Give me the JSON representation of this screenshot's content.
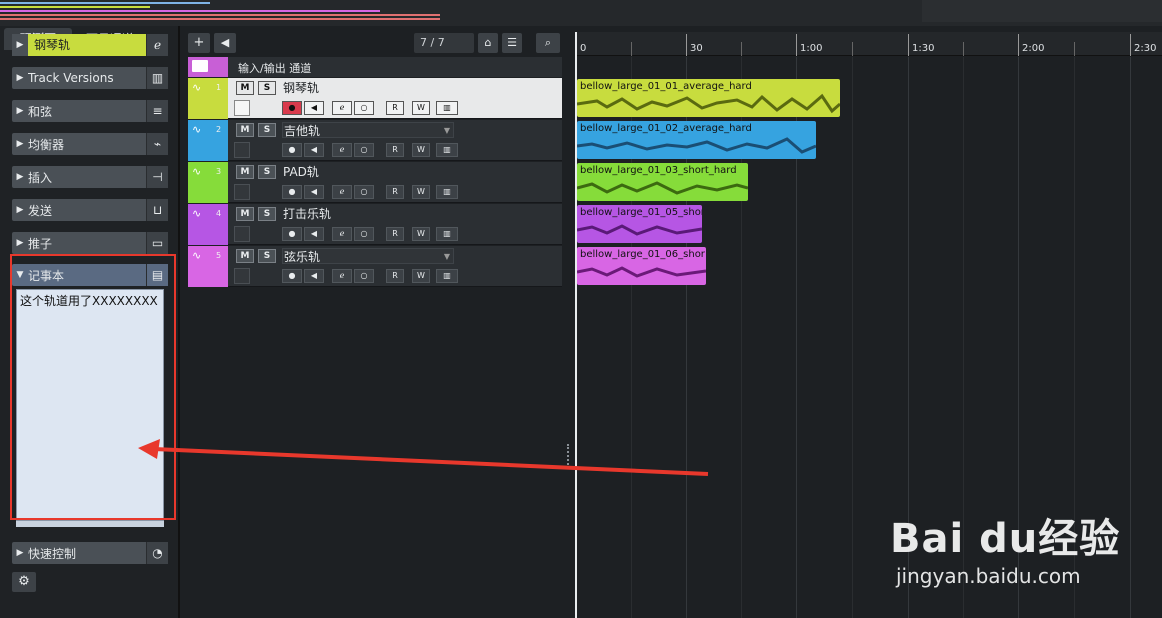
{
  "inspector": {
    "tabs": [
      "观测区",
      "可见通道",
      "="
    ],
    "track_name": "钢琴轨",
    "sections": [
      "Track Versions",
      "和弦",
      "均衡器",
      "插入",
      "发送",
      "推子"
    ],
    "notebook_title": "记事本",
    "notebook_text": "这个轨道用了XXXXXXXX",
    "quick_controls": "快速控制"
  },
  "toolbar": {
    "add": "+",
    "counter": "7 / 7"
  },
  "folder": {
    "label": "输入/输出 通道"
  },
  "tracks": [
    {
      "num": "1",
      "name": "钢琴轨",
      "color": "#c8dc3e"
    },
    {
      "num": "2",
      "name": "吉他轨",
      "color": "#36a3e0"
    },
    {
      "num": "3",
      "name": "PAD轨",
      "color": "#86dc3a"
    },
    {
      "num": "4",
      "name": "打击乐轨",
      "color": "#b656e4"
    },
    {
      "num": "5",
      "name": "弦乐轨",
      "color": "#d866e4"
    }
  ],
  "ruler": {
    "labels": [
      "0",
      "30",
      "1:00",
      "1:30",
      "2:00",
      "2:30"
    ]
  },
  "clips": [
    {
      "name": "bellow_large_01_01_average_hard"
    },
    {
      "name": "bellow_large_01_02_average_hard"
    },
    {
      "name": "bellow_large_01_03_short_hard"
    },
    {
      "name": "bellow_large_01_05_shor"
    },
    {
      "name": "bellow_large_01_06_shor"
    }
  ],
  "watermark": {
    "brand": "Bai du经验",
    "url": "jingyan.baidu.com"
  }
}
